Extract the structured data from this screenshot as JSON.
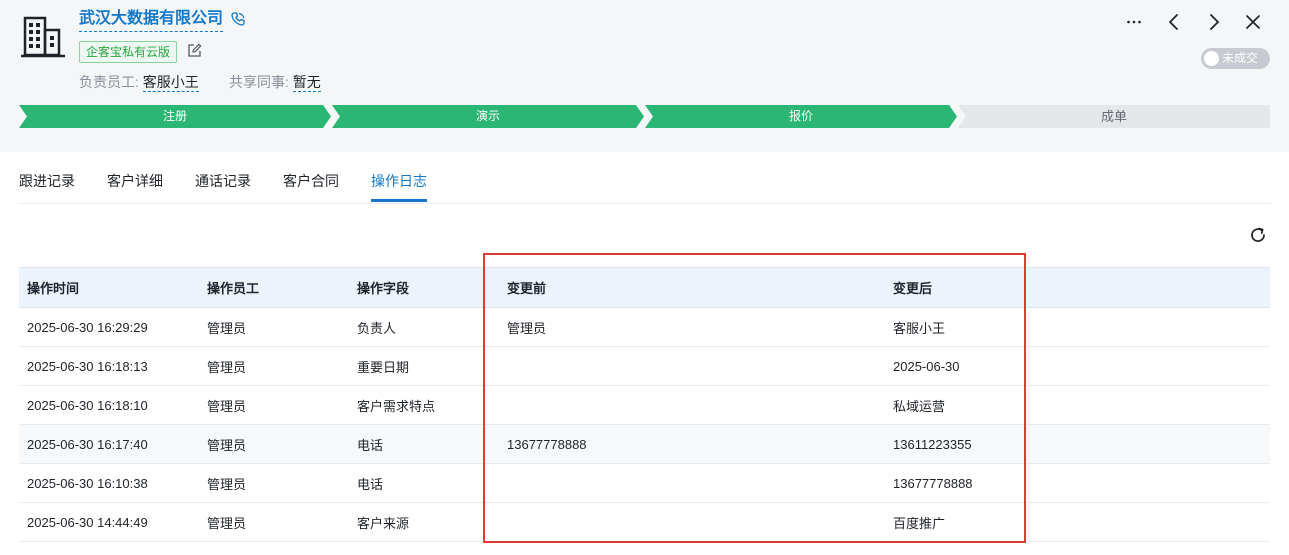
{
  "company": {
    "name": "武汉大数据有限公司",
    "badge": "企客宝私有云版",
    "owner_label": "负责员工:",
    "owner_value": "客服小王",
    "share_label": "共享同事:",
    "share_value": "暂无"
  },
  "toggle_label": "未成交",
  "stages": [
    {
      "label": "注册",
      "status": "done"
    },
    {
      "label": "演示",
      "status": "done"
    },
    {
      "label": "报价",
      "status": "done"
    },
    {
      "label": "成单",
      "status": "todo"
    }
  ],
  "tabs": [
    {
      "label": "跟进记录"
    },
    {
      "label": "客户详细"
    },
    {
      "label": "通话记录"
    },
    {
      "label": "客户合同"
    },
    {
      "label": "操作日志",
      "active": true
    }
  ],
  "log_table": {
    "columns": [
      "操作时间",
      "操作员工",
      "操作字段",
      "变更前",
      "变更后"
    ],
    "rows": [
      [
        "2025-06-30 16:29:29",
        "管理员",
        "负责人",
        "管理员",
        "客服小王"
      ],
      [
        "2025-06-30 16:18:13",
        "管理员",
        "重要日期",
        "",
        "2025-06-30"
      ],
      [
        "2025-06-30 16:18:10",
        "管理员",
        "客户需求特点",
        "",
        "私域运营"
      ],
      [
        "2025-06-30 16:17:40",
        "管理员",
        "电话",
        "13677778888",
        "13611223355"
      ],
      [
        "2025-06-30 16:10:38",
        "管理员",
        "电话",
        "",
        "13677778888"
      ],
      [
        "2025-06-30 14:44:49",
        "管理员",
        "客户来源",
        "",
        "百度推广"
      ]
    ]
  },
  "colors": {
    "accent": "#1677c9",
    "stage_done": "#2bb673",
    "stage_todo": "#e4e6ea",
    "highlight_box": "#e03a32"
  },
  "icons": [
    "building-icon",
    "phone-icon",
    "edit-icon",
    "more-icon",
    "prev-icon",
    "next-icon",
    "close-icon",
    "refresh-icon"
  ]
}
